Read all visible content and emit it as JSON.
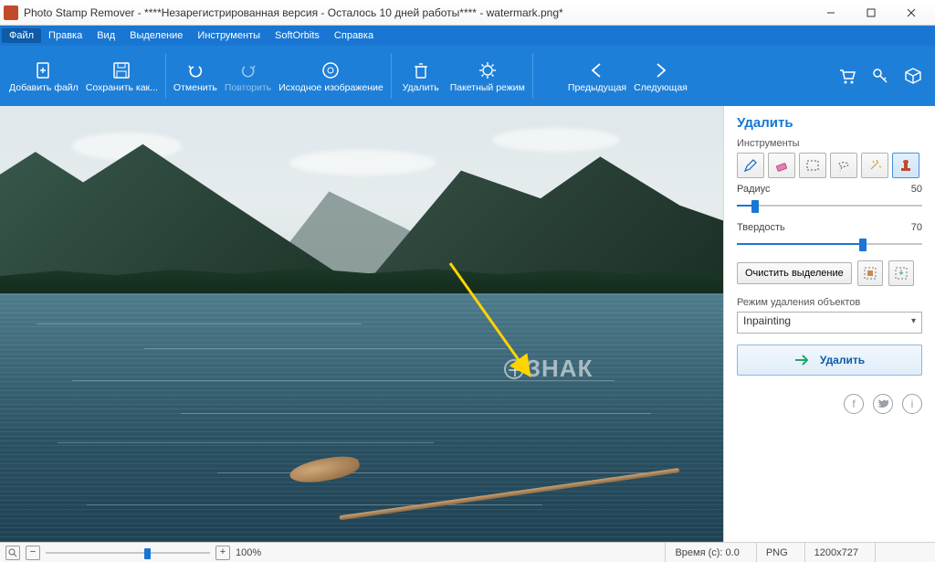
{
  "window": {
    "title": "Photo Stamp Remover - ****Незарегистрированная версия - Осталось 10 дней работы**** - watermark.png*"
  },
  "menu": {
    "items": [
      "Файл",
      "Правка",
      "Вид",
      "Выделение",
      "Инструменты",
      "SoftOrbits",
      "Справка"
    ],
    "active_index": 0
  },
  "toolbar": {
    "add_file": "Добавить файл",
    "save_as": "Сохранить как...",
    "undo": "Отменить",
    "redo": "Повторить",
    "original": "Исходное изображение",
    "remove": "Удалить",
    "batch": "Пакетный режим",
    "prev": "Предыдущая",
    "next": "Следующая"
  },
  "panel": {
    "title": "Удалить",
    "tools_label": "Инструменты",
    "tools": [
      "pencil",
      "eraser",
      "rect-select",
      "lasso",
      "magic-wand",
      "stamp"
    ],
    "selected_tool_index": 5,
    "radius_label": "Радиус",
    "radius_value": "50",
    "hardness_label": "Твердость",
    "hardness_value": "70",
    "clear_selection": "Очистить выделение",
    "mode_label": "Режим удаления объектов",
    "mode_value": "Inpainting",
    "run": "Удалить"
  },
  "canvas": {
    "watermark_text": "ЗНАК"
  },
  "status": {
    "zoom": "100%",
    "time_label": "Время (с):",
    "time_value": "0.0",
    "format": "PNG",
    "dimensions": "1200x727"
  }
}
